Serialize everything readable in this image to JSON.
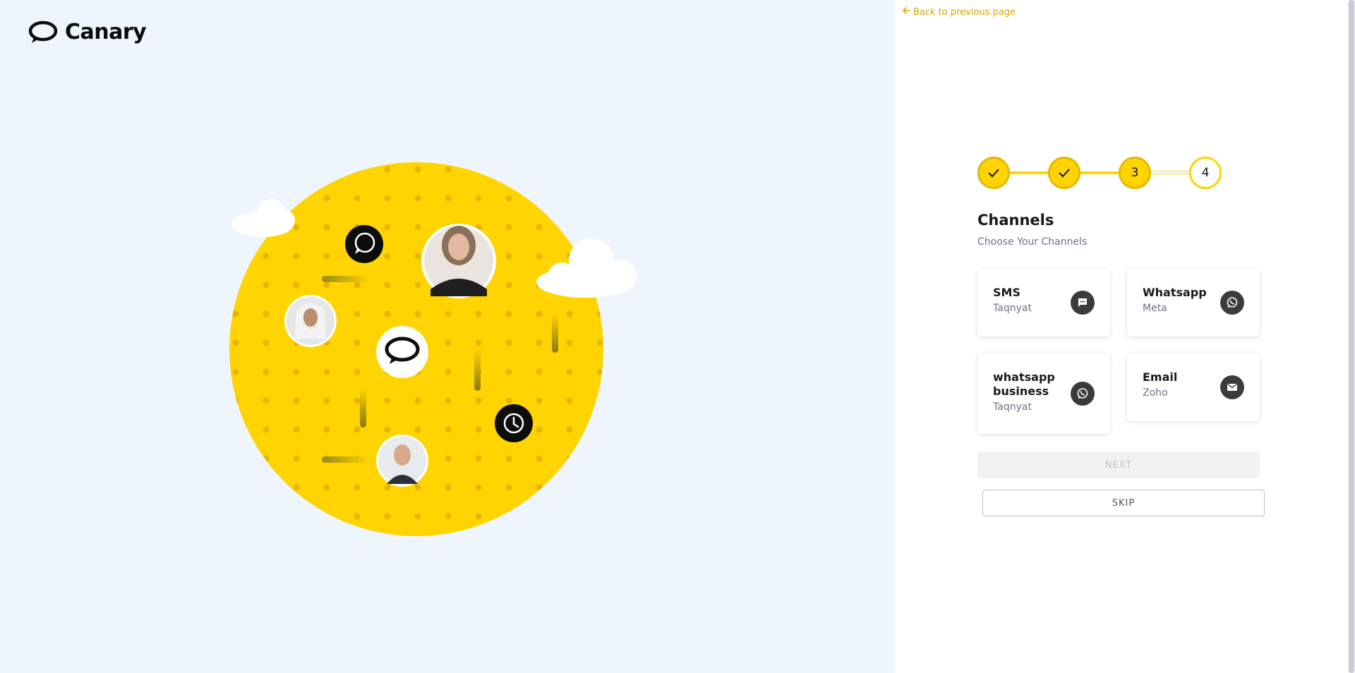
{
  "brand": {
    "name": "Canary"
  },
  "nav": {
    "back_label": "Back to previous page"
  },
  "stepper": {
    "steps": [
      "",
      "",
      "3",
      "4"
    ]
  },
  "page": {
    "title": "Channels",
    "subtitle": "Choose Your Channels"
  },
  "channels": [
    {
      "name": "SMS",
      "provider": "Taqnyat",
      "icon": "sms-icon"
    },
    {
      "name": "Whatsapp",
      "provider": "Meta",
      "icon": "whatsapp-icon"
    },
    {
      "name": "whatsapp business",
      "provider": "Taqnyat",
      "icon": "whatsapp-icon"
    },
    {
      "name": "Email",
      "provider": "Zoho",
      "icon": "email-icon"
    }
  ],
  "actions": {
    "next_label": "NEXT",
    "skip_label": "SKIP"
  },
  "colors": {
    "accent": "#ffd400",
    "background_left": "#eef5fd",
    "icon_bg": "#3b3b3b",
    "link": "#d4a600"
  }
}
